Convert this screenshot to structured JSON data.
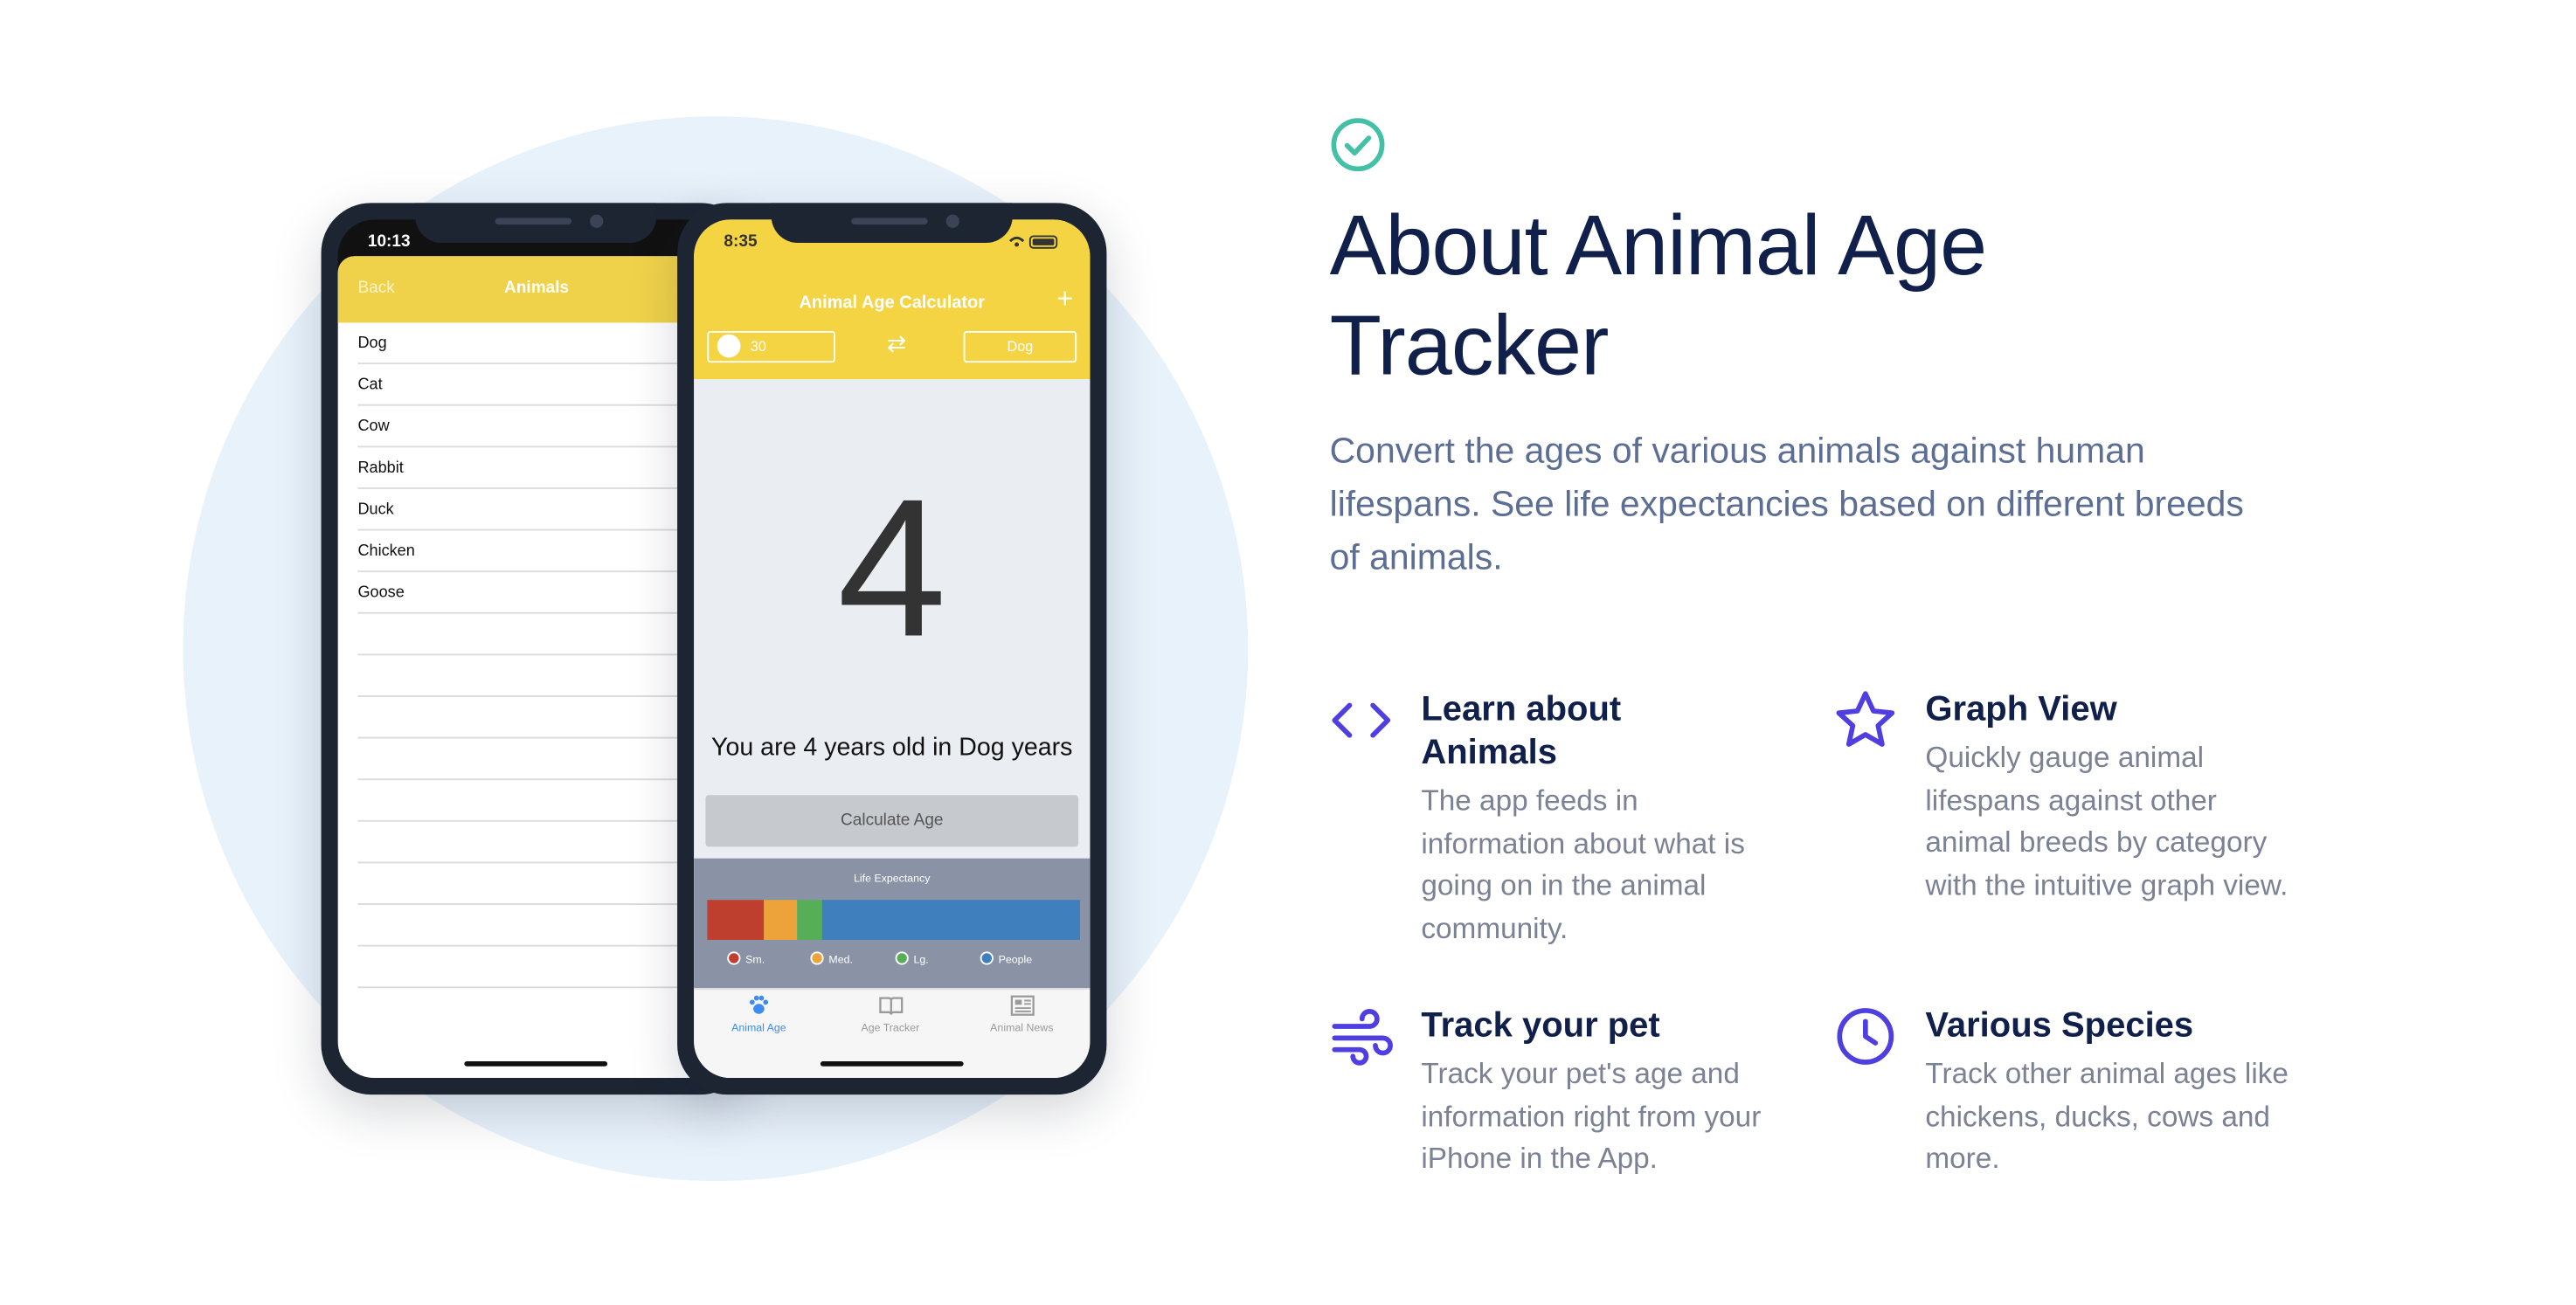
{
  "colors": {
    "accent": "#4f3fe0",
    "check": "#43c0a5",
    "heading": "#10204a",
    "app_yellow": "#f5d444",
    "life_expectancy": {
      "small": "#bf3f2f",
      "medium": "#eda33a",
      "large": "#56ae57",
      "people": "#3f7fbd"
    }
  },
  "back_phone": {
    "time": "10:13",
    "nav_back": "Back",
    "nav_title": "Animals",
    "animals": [
      "Dog",
      "Cat",
      "Cow",
      "Rabbit",
      "Duck",
      "Chicken",
      "Goose"
    ]
  },
  "front_phone": {
    "time": "8:35",
    "title": "Animal Age Calculator",
    "human_age": "30",
    "species": "Dog",
    "result_number": "4",
    "result_text": "You are 4 years old in Dog years",
    "calculate_button": "Calculate Age",
    "life_expectancy_title": "Life Expectancy",
    "life_expectancy_segments": [
      {
        "key": "small",
        "fraction": 0.15
      },
      {
        "key": "medium",
        "fraction": 0.09
      },
      {
        "key": "large",
        "fraction": 0.07
      },
      {
        "key": "people",
        "fraction": 0.69
      }
    ],
    "legend": {
      "small": "Sm.",
      "medium": "Med.",
      "large": "Lg.",
      "people": "People"
    },
    "tabs": [
      {
        "label": "Animal Age",
        "icon": "paw-icon",
        "active": true
      },
      {
        "label": "Age Tracker",
        "icon": "book-icon",
        "active": false
      },
      {
        "label": "Animal News",
        "icon": "news-icon",
        "active": false
      }
    ]
  },
  "about": {
    "title": "About Animal Age Tracker",
    "description": "Convert the ages of various animals against human lifespans. See life expectancies based on different breeds of animals."
  },
  "features": [
    {
      "icon": "code-brackets-icon",
      "title": "Learn about Animals",
      "text": "The app feeds in information about what is going on in the animal community."
    },
    {
      "icon": "star-icon",
      "title": "Graph View",
      "text": "Quickly gauge animal lifespans against other animal breeds by category with the intuitive graph view."
    },
    {
      "icon": "wind-icon",
      "title": "Track your pet",
      "text": "Track your pet's age and information right from your iPhone in the App."
    },
    {
      "icon": "clock-icon",
      "title": "Various Species",
      "text": "Track other animal ages like chickens, ducks, cows and more."
    }
  ]
}
